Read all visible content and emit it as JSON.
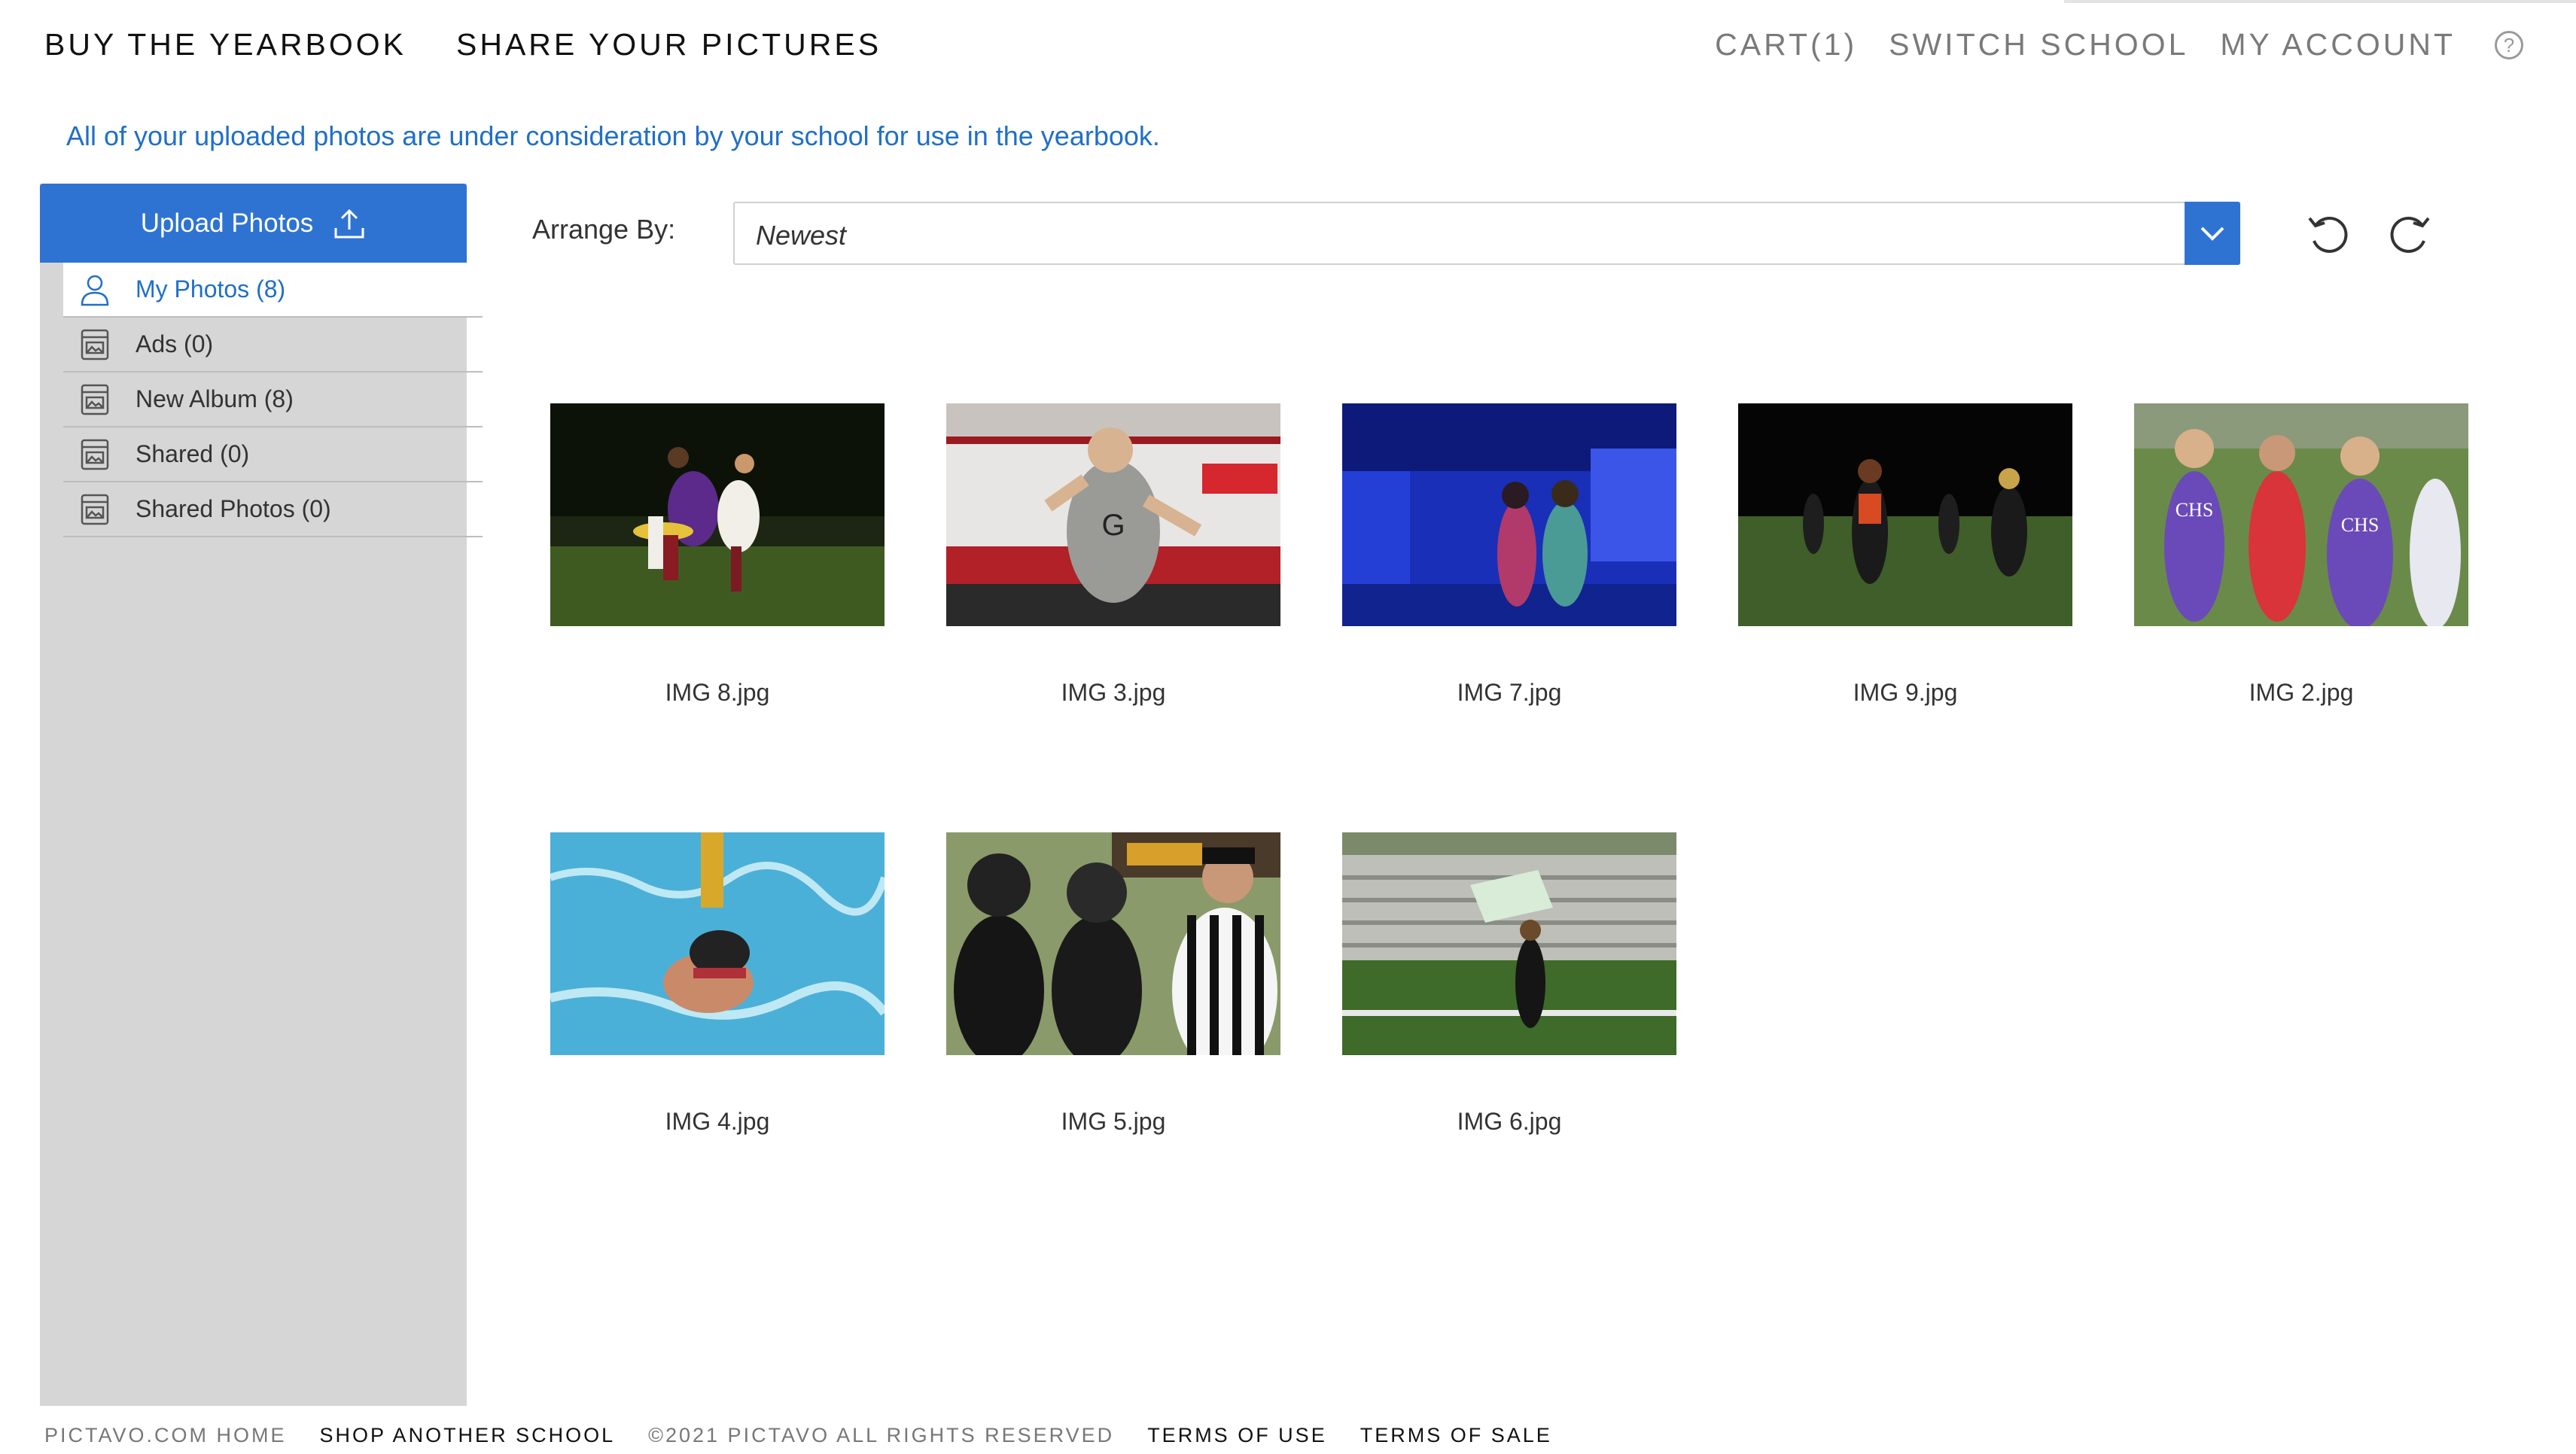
{
  "nav": {
    "left": [
      "BUY THE YEARBOOK",
      "SHARE YOUR PICTURES"
    ],
    "right": [
      "CART(1)",
      "SWITCH SCHOOL",
      "MY ACCOUNT"
    ],
    "help_icon": "question-circle-icon"
  },
  "notice": "All of your uploaded photos are under consideration by your school for use in the yearbook.",
  "sidebar": {
    "upload_label": "Upload Photos",
    "upload_icon": "upload-icon",
    "items": [
      {
        "label": "My Photos (8)",
        "icon": "user-icon",
        "active": true
      },
      {
        "label": "Ads (0)",
        "icon": "album-icon",
        "active": false
      },
      {
        "label": "New Album (8)",
        "icon": "album-icon",
        "active": false
      },
      {
        "label": "Shared (0)",
        "icon": "album-icon",
        "active": false
      },
      {
        "label": "Shared Photos (0)",
        "icon": "album-icon",
        "active": false
      }
    ]
  },
  "arrange": {
    "label": "Arrange By:",
    "selected": "Newest"
  },
  "photos": [
    {
      "name": "IMG 8.jpg"
    },
    {
      "name": "IMG 3.jpg"
    },
    {
      "name": "IMG 7.jpg"
    },
    {
      "name": "IMG 9.jpg"
    },
    {
      "name": "IMG 2.jpg"
    },
    {
      "name": "IMG 4.jpg"
    },
    {
      "name": "IMG 5.jpg"
    },
    {
      "name": "IMG 6.jpg"
    }
  ],
  "footer": {
    "home": "PICTAVO.COM HOME",
    "shop": "SHOP ANOTHER SCHOOL",
    "copyright": "©2021 PICTAVO ALL RIGHTS RESERVED",
    "terms_use": "TERMS OF USE",
    "terms_sale": "TERMS OF SALE"
  },
  "colors": {
    "accent": "#2f73d2",
    "link": "#1f6fc9",
    "sidebar_bg": "#d6d6d6"
  }
}
